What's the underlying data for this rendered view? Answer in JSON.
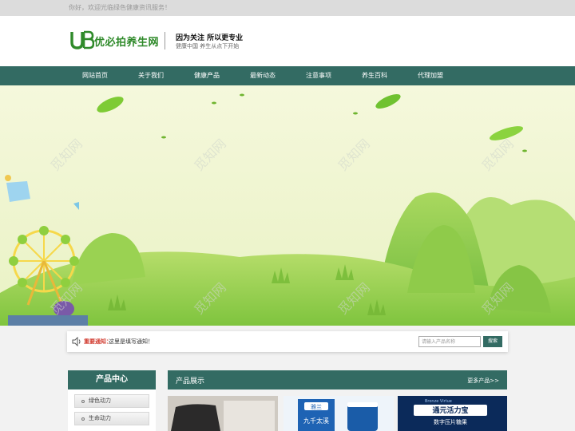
{
  "topbar": {
    "greeting": "你好，欢迎光临绿色健康资讯服务！"
  },
  "header": {
    "logo_text": "优必拍养生网",
    "slogan_main": "因为关注  所以更专业",
    "slogan_sub": "健康中国  养生从点下开始"
  },
  "nav": {
    "items": [
      "网站首页",
      "关于我们",
      "健康产品",
      "最新动态",
      "注意事项",
      "养生百科",
      "代理加盟"
    ]
  },
  "banner": {
    "watermark": "觅知网"
  },
  "notice": {
    "label": "重要通知：",
    "text": "这里是填写通知！",
    "search_placeholder": "请输入产品名称",
    "search_button": "搜索"
  },
  "sidebar": {
    "title": "产品中心",
    "items": [
      "绿色动力",
      "生命动力"
    ]
  },
  "products": {
    "title": "产品展示",
    "more": "更多产品>>",
    "items": [
      {
        "caption": ""
      },
      {
        "brand": "雅兰",
        "caption": "九千太溪"
      },
      {
        "brand": "Bronze Virtue",
        "caption": "通元活力宝",
        "subcaption": "数字压片糖果"
      }
    ]
  },
  "colors": {
    "primary": "#336b63",
    "banner_sky": "#f3f7d8",
    "grass": "#7fc43e",
    "notice_red": "#d23b2f"
  }
}
